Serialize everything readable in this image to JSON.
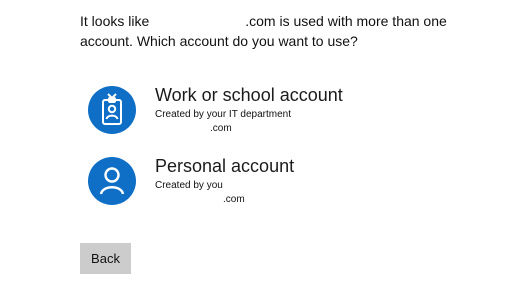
{
  "prompt": {
    "before": "It looks like",
    "after": ".com is used with more than one account. Which account do you want to use?"
  },
  "accounts": [
    {
      "title": "Work or school account",
      "subtitle": "Created by your IT department",
      "email_suffix": ".com",
      "icon": "id-badge-icon"
    },
    {
      "title": "Personal account",
      "subtitle": "Created by you",
      "email_suffix": ".com",
      "icon": "person-icon"
    }
  ],
  "back_label": "Back",
  "colors": {
    "accent": "#0f6fc6",
    "button_bg": "#cccccc",
    "text": "#1b1b1b"
  }
}
